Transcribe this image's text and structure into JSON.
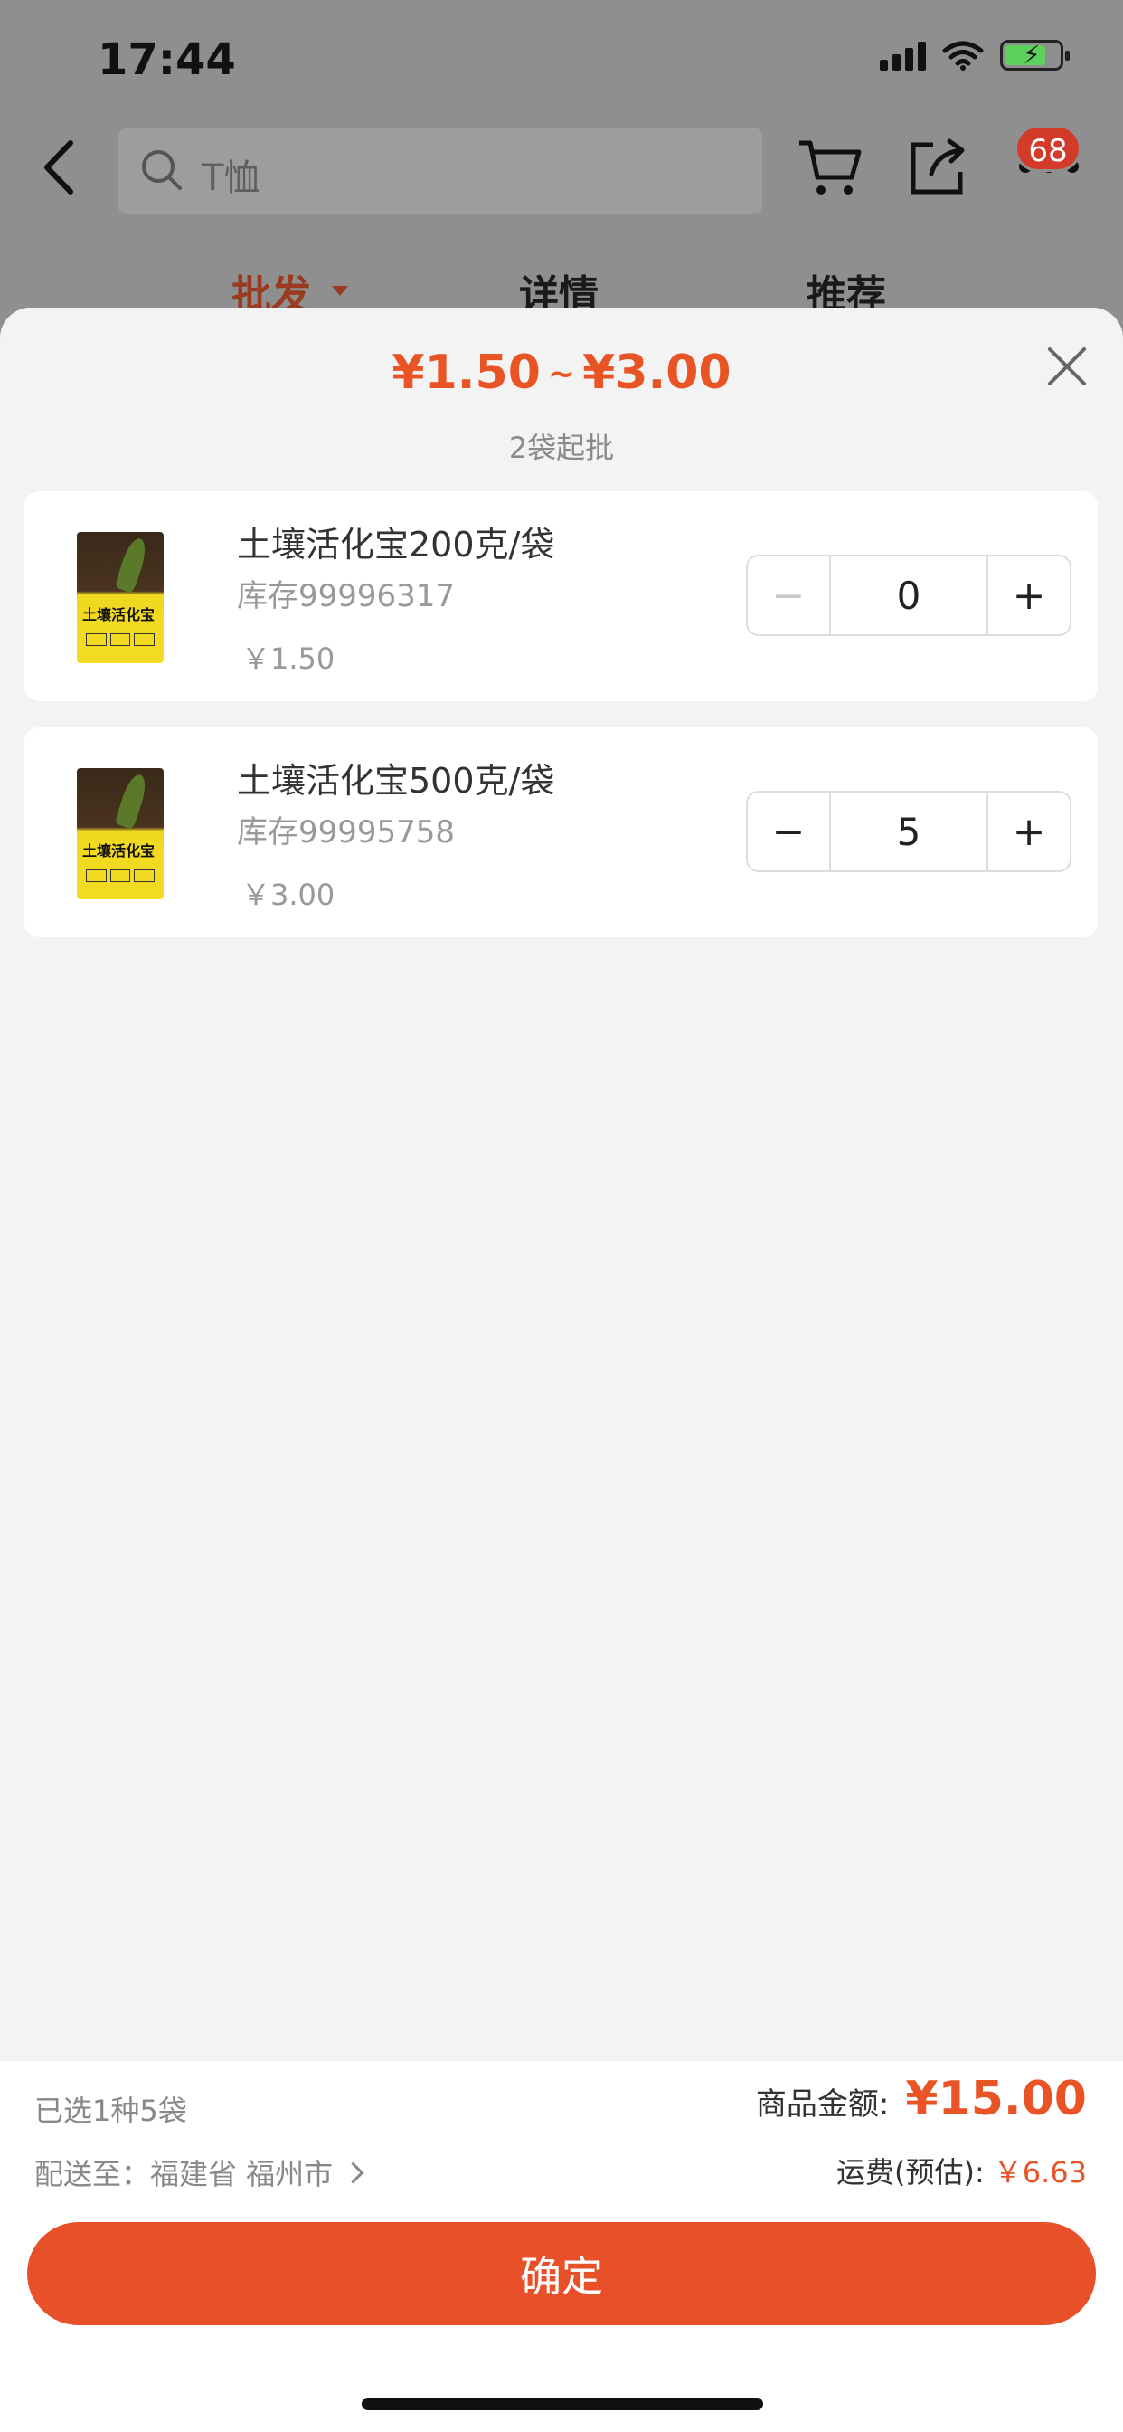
{
  "status_bar": {
    "time": "17:44"
  },
  "header": {
    "search_placeholder": "T恤",
    "cart_badge": "68"
  },
  "tabs": [
    {
      "label": "批发",
      "active": true
    },
    {
      "label": "详情",
      "active": false
    },
    {
      "label": "推荐",
      "active": false
    }
  ],
  "sheet": {
    "price_min": "¥1.50",
    "price_sep": "~",
    "price_max": "¥3.00",
    "min_order": "2袋起批"
  },
  "items": [
    {
      "name": "土壤活化宝200克/袋",
      "stock": "库存99996317",
      "price": "￥1.50",
      "qty": "0",
      "image_label": "土壤活化宝"
    },
    {
      "name": "土壤活化宝500克/袋",
      "stock": "库存99995758",
      "price": "￥3.00",
      "qty": "5",
      "image_label": "土壤活化宝"
    }
  ],
  "footer": {
    "selected_summary": "已选1种5袋",
    "ship_to": "配送至：福建省 福州市",
    "amount_label": "商品金额:",
    "amount_value": "¥15.00",
    "freight_label": "运费(预估):",
    "freight_value": "￥6.63",
    "confirm_label": "确定"
  },
  "colors": {
    "accent": "#e8502a",
    "price": "#e85426",
    "badge": "#d23a2a"
  },
  "icons": [
    "back-icon",
    "search-icon",
    "cart-icon",
    "share-icon",
    "more-icon",
    "close-icon",
    "minus-icon",
    "plus-icon",
    "chevron-right-icon"
  ]
}
